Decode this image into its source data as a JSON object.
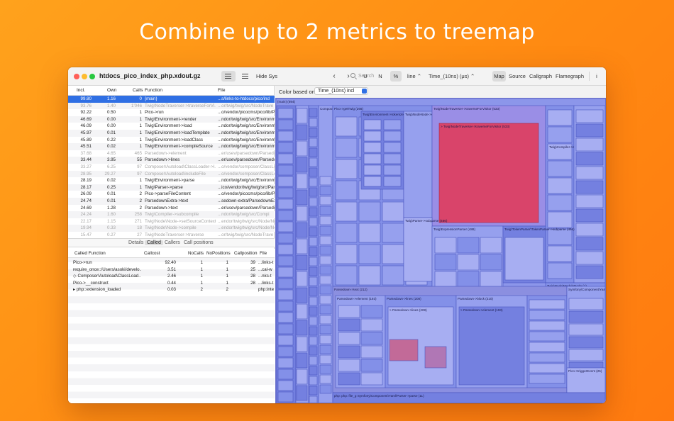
{
  "headline": "Combine up to 2 metrics to treemap",
  "window": {
    "title": "htdocs_pico_index_php.xdout.gz"
  },
  "toolbar": {
    "hide_sys_label": "Hide Sys",
    "search_placeholder": "Search",
    "u_label": "U",
    "n_label": "N",
    "pct_label": "%",
    "line_select": "line",
    "metric_select": "Time_(10ns) (μs)",
    "map_label": "Map",
    "source_label": "Source",
    "callgraph_label": "Callgraph",
    "flamegraph_label": "Flamegraph",
    "info_label": "i"
  },
  "main_table": {
    "headers": {
      "incl": "Incl.",
      "own": "Own",
      "calls": "Calls",
      "function": "Function",
      "file": "File"
    },
    "rows": [
      {
        "incl": "99.80",
        "own": "1.16",
        "calls": "0",
        "function": "{main}",
        "file": "...s/links-to-htdocs/pico/ind",
        "selected": true
      },
      {
        "incl": "93.76",
        "own": "1.40",
        "calls": "1'046",
        "function": "Twig\\NodeTraverser->traverseForVi...",
        "file": "...or/twig/twig/src/NodeTrave",
        "dim": true
      },
      {
        "incl": "92.22",
        "own": "0.50",
        "calls": "1",
        "function": "Pico->run",
        "file": "...o/vendor/picocms/pico/lib/P"
      },
      {
        "incl": "46.69",
        "own": "0.00",
        "calls": "1",
        "function": "Twig\\Environment->render",
        "file": "...ndor/twig/twig/src/Environm"
      },
      {
        "incl": "46.09",
        "own": "0.00",
        "calls": "1",
        "function": "Twig\\Environment->load",
        "file": "...ndor/twig/twig/src/Environm"
      },
      {
        "incl": "45.97",
        "own": "0.01",
        "calls": "1",
        "function": "Twig\\Environment->loadTemplate",
        "file": "...ndor/twig/twig/src/Environm"
      },
      {
        "incl": "45.89",
        "own": "0.22",
        "calls": "1",
        "function": "Twig\\Environment->loadClass",
        "file": "...ndor/twig/twig/src/Environm"
      },
      {
        "incl": "45.51",
        "own": "0.02",
        "calls": "1",
        "function": "Twig\\Environment->compileSource",
        "file": "...ndor/twig/twig/src/Environm"
      },
      {
        "incl": "37.68",
        "own": "4.65",
        "calls": "465",
        "function": "Parsedown->element",
        "file": "...er/usev/parsedown/Parsedo",
        "dim": true
      },
      {
        "incl": "33.44",
        "own": "3.95",
        "calls": "55",
        "function": "Parsedown->lines",
        "file": "...er/usev/parsedown/Parsedo"
      },
      {
        "incl": "33.27",
        "own": "6.25",
        "calls": "97",
        "function": "Composer\\Autoload\\ClassLoader->l...",
        "file": "...o/vendor/composer/ClassLoa",
        "dim": true
      },
      {
        "incl": "28.95",
        "own": "29.27",
        "calls": "97",
        "function": "Composer\\Autoload\\includeFile",
        "file": "...o/vendor/composer/ClassLoa",
        "dim": true
      },
      {
        "incl": "28.19",
        "own": "0.02",
        "calls": "1",
        "function": "Twig\\Environment->parse",
        "file": "...ndor/twig/twig/src/Environm"
      },
      {
        "incl": "28.17",
        "own": "0.25",
        "calls": "1",
        "function": "Twig\\Parser->parse",
        "file": "...ico/vendor/twig/twig/src/Par"
      },
      {
        "incl": "26.09",
        "own": "0.01",
        "calls": "2",
        "function": "Pico->parseFileContent",
        "file": "...o/vendor/picocms/pico/lib/P"
      },
      {
        "incl": "24.74",
        "own": "0.01",
        "calls": "2",
        "function": "ParsedownExtra->text",
        "file": "...sedown-extra/ParsedownExtr"
      },
      {
        "incl": "24.69",
        "own": "1.28",
        "calls": "2",
        "function": "Parsedown->text",
        "file": "...er/usev/parsedown/Parsedo"
      },
      {
        "incl": "24.24",
        "own": "1.60",
        "calls": "258",
        "function": "Twig\\Compiler->subcompile",
        "file": "...ndor/twig/twig/src/Compi",
        "dim": true
      },
      {
        "incl": "22.17",
        "own": "1.15",
        "calls": "271",
        "function": "Twig\\Node\\Node->setSourceContext",
        "file": "...endor/twig/twig/src/Node/No",
        "dim": true
      },
      {
        "incl": "19.94",
        "own": "0.33",
        "calls": "18",
        "function": "Twig\\Node\\Node->compile",
        "file": "...endor/twig/twig/src/Node/No",
        "dim": true
      },
      {
        "incl": "15.47",
        "own": "0.27",
        "calls": "27",
        "function": "Twig\\NodeTraverser->traverse",
        "file": "...or/twig/twig/src/NodeTrave",
        "dim": true
      }
    ]
  },
  "tabs": {
    "details": "Details",
    "called": "Called",
    "callers": "Callers",
    "positions": "Call positions"
  },
  "called_table": {
    "headers": {
      "fn": "Called Function",
      "cost": "Callcost",
      "nc": "NoCalls",
      "np": "NoPositions",
      "cp": "Callposition",
      "file": "File"
    },
    "rows": [
      {
        "fn": "Pico->run",
        "cost": "92.40",
        "nc": "1",
        "np": "1",
        "cp": "39",
        "file": "...links-t"
      },
      {
        "fn": "require_once::/Users/asoki/develo...",
        "cost": "3.51",
        "nc": "1",
        "np": "1",
        "cp": "25",
        "file": "...cal-w"
      },
      {
        "fn": "◇ Composer\\Autoload\\ClassLoad...",
        "cost": "2.46",
        "nc": "1",
        "np": "1",
        "cp": "28",
        "file": "...nks-t"
      },
      {
        "fn": "Pico->__construct",
        "cost": "0.44",
        "nc": "1",
        "np": "1",
        "cp": "28",
        "file": "...links-t"
      },
      {
        "fn": "▸ php::extension_loaded",
        "cost": "0.03",
        "nc": "2",
        "np": "2",
        "cp": "",
        "file": "php:inte"
      }
    ]
  },
  "treemap": {
    "color_label": "Color based on",
    "color_metric": "Time_(10ns) incl",
    "labels": {
      "main": "{main} (894)",
      "traverse_visitor_a": "Twig\\NodeTraverser->traverseForVisitor (533)",
      "traverse_visitor_b": "> Twig\\NodeTraverser->traverseForVisitor (533)",
      "picoget": "Pico->getTwig (266)",
      "compile": "Twig\\Compiler->subcompile (22)",
      "text": "Parsedown->text (212)",
      "lines": "Parsedown->lines (208)",
      "element": "Parsedown->element (193)",
      "block210": "Parsedown->block (210)",
      "element2": "> Parsedown->element (193)",
      "lines2": "> Parsedown->lines (208)",
      "parseeg": "php: php: file_g Symfony\\Component\\Yaml\\Parser->parse (11)",
      "symfony": "Symfony\\Component\\Yaml\\Parser->doParse (134)",
      "twigparser": "Twig\\Parser->subparse (466)",
      "expr": "Twig\\ExpressionParser (488)",
      "tokenparser": "Twig\\TokenParser\\TokenParser->subparse (466)",
      "lexer": "Twig\\Environment->tokenize (266)",
      "composer": "Composer\\Autoload\\includeFile (22)",
      "nodevisit": "Twig\\NodeNode->setSourceContext (522)",
      "nodemodule": "Twig\\Node\\ModuleNode (1)",
      "pico_trigger": "Pico->triggerEvent (25)"
    }
  }
}
